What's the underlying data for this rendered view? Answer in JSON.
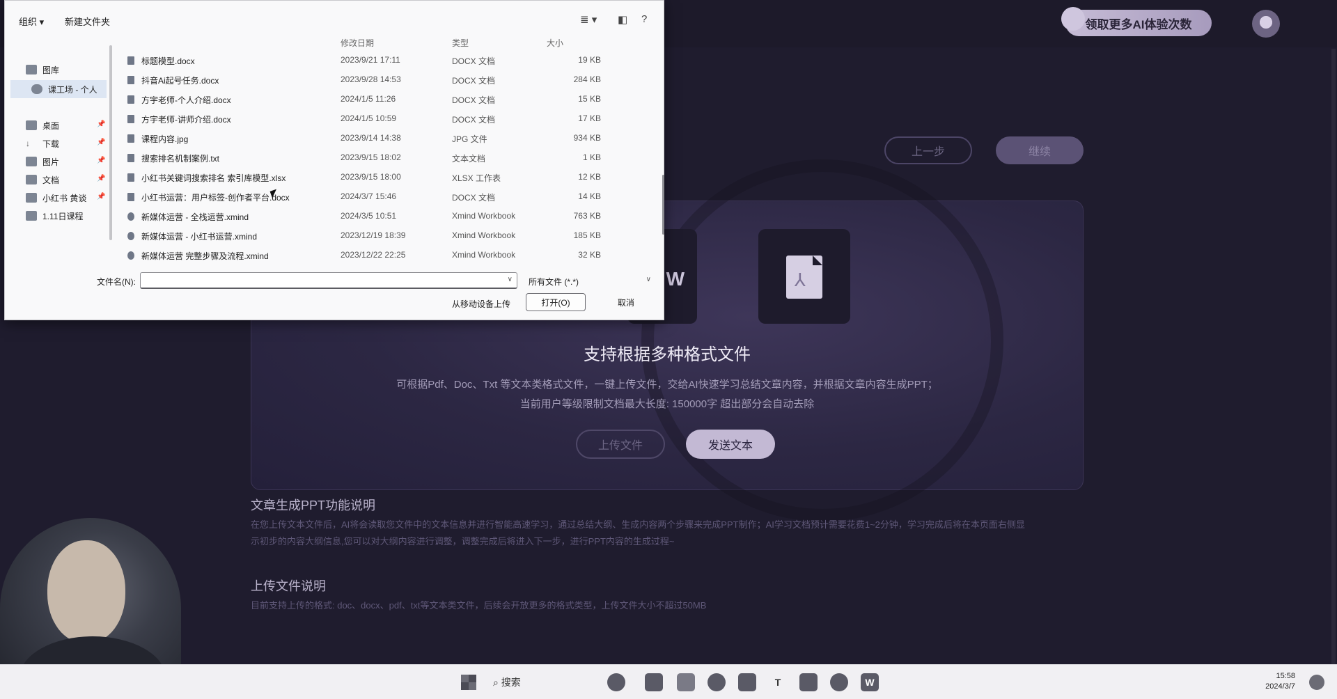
{
  "web": {
    "promo_label": "领取更多AI体验次数",
    "prev_label": "上一步",
    "next_label": "继续",
    "panel_title": "支持根据多种格式文件",
    "panel_desc_1": "可根据Pdf、Doc、Txt 等文本类格式文件，一键上传文件，交给AI快速学习总结文章内容，并根据文章内容生成PPT；",
    "panel_desc_2": "当前用户等级限制文档最大长度: 150000字 超出部分会自动去除",
    "upload_file_label": "上传文件",
    "send_text_label": "发送文本",
    "word_tile_letter": "W",
    "pdf_symbol": "⅄",
    "sec1_title": "文章生成PPT功能说明",
    "sec1_body_1": "在您上传文本文件后，AI将会读取您文件中的文本信息并进行智能高速学习，通过总结大纲、生成内容两个步骤来完成PPT制作；AI学习文档预计需要花费1~2分钟，学习完成后将在本页面右侧显",
    "sec1_body_2": "示初步的内容大纲信息,您可以对大纲内容进行调整，调整完成后将进入下一步，进行PPT内容的生成过程~",
    "sec2_title": "上传文件说明",
    "sec2_body": "目前支持上传的格式: doc、docx、pdf、txt等文本类文件，后续会开放更多的格式类型，上传文件大小不超过50MB"
  },
  "dialog": {
    "toolbar": {
      "organize": "组织 ▾",
      "new_folder": "新建文件夹"
    },
    "nav": [
      {
        "label": "图库",
        "icon": "gallery-icon"
      },
      {
        "label": "课工场 - 个人",
        "icon": "cloud-icon"
      },
      {
        "label": "桌面",
        "icon": "desktop-icon"
      },
      {
        "label": "下载",
        "icon": "download-icon"
      },
      {
        "label": "图片",
        "icon": "pictures-icon"
      },
      {
        "label": "文档",
        "icon": "documents-icon"
      },
      {
        "label": "小红书 黄谈",
        "icon": "folder-icon"
      },
      {
        "label": "1.11日课程",
        "icon": "folder-icon"
      }
    ],
    "columns": {
      "date": "修改日期",
      "type": "类型",
      "size": "大小"
    },
    "files": [
      {
        "name": "标题模型.docx",
        "date": "2023/9/21 17:11",
        "type": "DOCX 文档",
        "size": "19 KB"
      },
      {
        "name": "抖音Ai起号任务.docx",
        "date": "2023/9/28 14:53",
        "type": "DOCX 文档",
        "size": "284 KB"
      },
      {
        "name": "方宇老师-个人介绍.docx",
        "date": "2024/1/5 11:26",
        "type": "DOCX 文档",
        "size": "15 KB"
      },
      {
        "name": "方宇老师-讲师介绍.docx",
        "date": "2024/1/5 10:59",
        "type": "DOCX 文档",
        "size": "17 KB"
      },
      {
        "name": "课程内容.jpg",
        "date": "2023/9/14 14:38",
        "type": "JPG 文件",
        "size": "934 KB"
      },
      {
        "name": "搜索排名机制案例.txt",
        "date": "2023/9/15 18:02",
        "type": "文本文档",
        "size": "1 KB"
      },
      {
        "name": "小红书关键词搜索排名 索引库模型.xlsx",
        "date": "2023/9/15 18:00",
        "type": "XLSX 工作表",
        "size": "12 KB"
      },
      {
        "name": "小红书运营：用户标签-创作者平台.docx",
        "date": "2024/3/7 15:46",
        "type": "DOCX 文档",
        "size": "14 KB"
      },
      {
        "name": "新媒体运营 - 全栈运营.xmind",
        "date": "2024/3/5 10:51",
        "type": "Xmind Workbook",
        "size": "763 KB"
      },
      {
        "name": "新媒体运营 - 小红书运营.xmind",
        "date": "2023/12/19 18:39",
        "type": "Xmind Workbook",
        "size": "185 KB"
      },
      {
        "name": "新媒体运营 完整步骤及流程.xmind",
        "date": "2023/12/22 22:25",
        "type": "Xmind Workbook",
        "size": "32 KB"
      }
    ],
    "filename_label": "文件名(N):",
    "filename_value": "",
    "filter_value": "所有文件 (*.*)",
    "mobile_upload": "从移动设备上传",
    "open_label": "打开(O)",
    "cancel_label": "取消"
  },
  "taskbar": {
    "search_label": "搜索",
    "app_t": "T",
    "app_w": "W",
    "time": "15:58",
    "date": "2024/3/7"
  }
}
